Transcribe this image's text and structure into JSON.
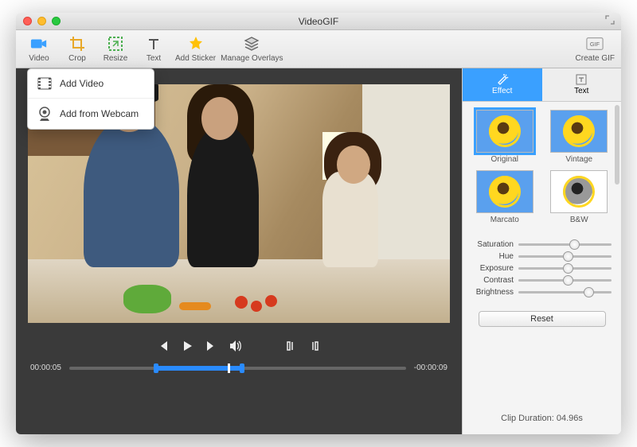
{
  "window": {
    "title": "VideoGIF"
  },
  "toolbar": {
    "video": "Video",
    "crop": "Crop",
    "resize": "Resize",
    "text": "Text",
    "sticker": "Add Sticker",
    "overlays": "Manage Overlays",
    "create": "Create GIF"
  },
  "dropdown": {
    "add_video": "Add Video",
    "add_webcam": "Add from Webcam"
  },
  "playback": {
    "time_left": "00:00:05",
    "time_right": "-00:00:09"
  },
  "panel": {
    "tabs": {
      "effect": "Effect",
      "text": "Text"
    },
    "effects": {
      "original": "Original",
      "vintage": "Vintage",
      "marcato": "Marcato",
      "bw": "B&W"
    },
    "sliders": {
      "saturation": "Saturation",
      "hue": "Hue",
      "exposure": "Exposure",
      "contrast": "Contrast",
      "brightness": "Brightness"
    },
    "reset": "Reset",
    "clip_duration_label": "Clip Duration:",
    "clip_duration_value": "04.96s"
  }
}
